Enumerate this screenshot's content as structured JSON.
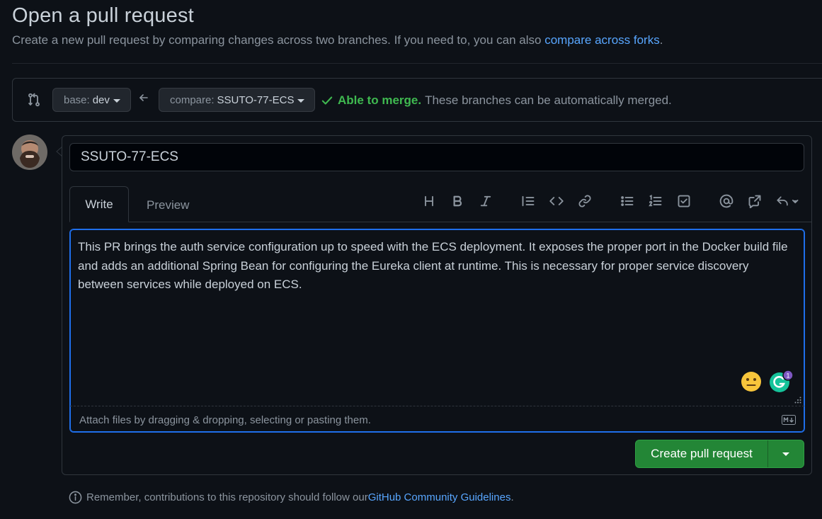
{
  "page": {
    "title": "Open a pull request",
    "subtitle_text": "Create a new pull request by comparing changes across two branches. If you need to, you can also ",
    "subtitle_link": "compare across forks",
    "subtitle_end": "."
  },
  "range": {
    "base_label": "base:",
    "base_value": "dev",
    "compare_label": "compare:",
    "compare_value": "SSUTO-77-ECS",
    "merge_ok": "Able to merge.",
    "merge_message": "These branches can be automatically merged."
  },
  "form": {
    "title_value": "SSUTO-77-ECS",
    "tabs": [
      {
        "label": "Write"
      },
      {
        "label": "Preview"
      }
    ],
    "toolbar": [
      "heading-icon",
      "bold-icon",
      "italic-icon",
      "quote-icon",
      "code-icon",
      "link-icon",
      "bulleted-list-icon",
      "numbered-list-icon",
      "task-list-icon",
      "mention-icon",
      "cross-reference-icon",
      "reply-icon"
    ],
    "body": "This PR brings the auth service configuration up to speed with the ECS deployment. It exposes the proper port in the Docker build file and adds an additional Spring Bean for configuring the Eureka client at runtime. This is necessary for proper service discovery between services while deployed on ECS.",
    "attach_hint": "Attach files by dragging & dropping, selecting or pasting them.",
    "grammarly_count": "1",
    "submit_label": "Create pull request"
  },
  "footer": {
    "note_text": "Remember, contributions to this repository should follow our ",
    "note_link": "GitHub Community Guidelines",
    "note_end": "."
  },
  "colors": {
    "background": "#0d1117",
    "link": "#58a6ff",
    "success": "#3fb950",
    "primary_button": "#238636",
    "focus": "#1f6feb"
  }
}
